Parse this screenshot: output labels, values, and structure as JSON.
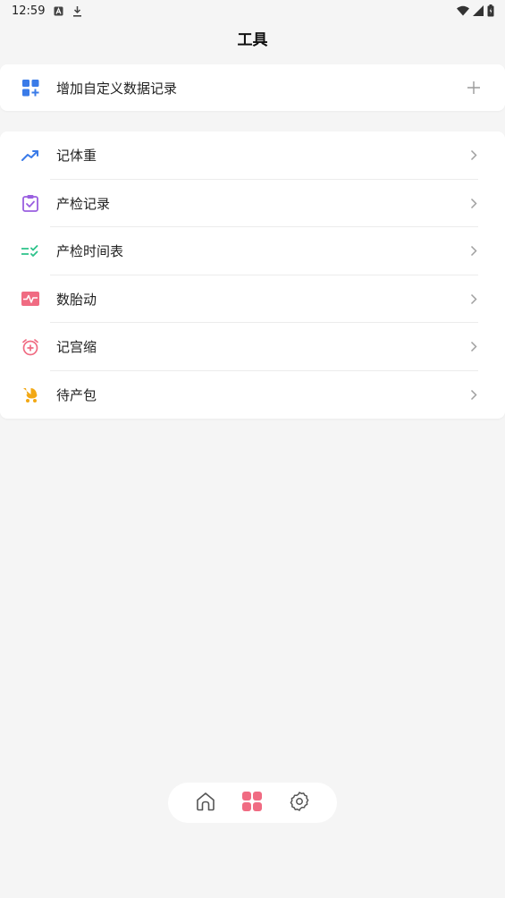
{
  "status_bar": {
    "time": "12:59"
  },
  "header": {
    "title": "工具"
  },
  "add_record": {
    "label": "增加自定义数据记录",
    "icon": "grid-plus-icon",
    "trail_icon": "plus-icon"
  },
  "tools": {
    "items": [
      {
        "label": "记体重",
        "icon": "trend-up-icon",
        "color": "#3a7be8"
      },
      {
        "label": "产检记录",
        "icon": "clipboard-check-icon",
        "color": "#9a5fe0"
      },
      {
        "label": "产检时间表",
        "icon": "checklist-icon",
        "color": "#2cc28a"
      },
      {
        "label": "数胎动",
        "icon": "heartbeat-icon",
        "color": "#f06b82"
      },
      {
        "label": "记宫缩",
        "icon": "alarm-plus-icon",
        "color": "#f06b82"
      },
      {
        "label": "待产包",
        "icon": "stroller-icon",
        "color": "#f2a814"
      }
    ]
  },
  "bottom_nav": {
    "items": [
      {
        "icon": "home-icon",
        "active": false
      },
      {
        "icon": "tools-grid-icon",
        "active": true
      },
      {
        "icon": "gear-icon",
        "active": false
      }
    ],
    "active_color": "#f06b82",
    "inactive_color": "#555555"
  }
}
